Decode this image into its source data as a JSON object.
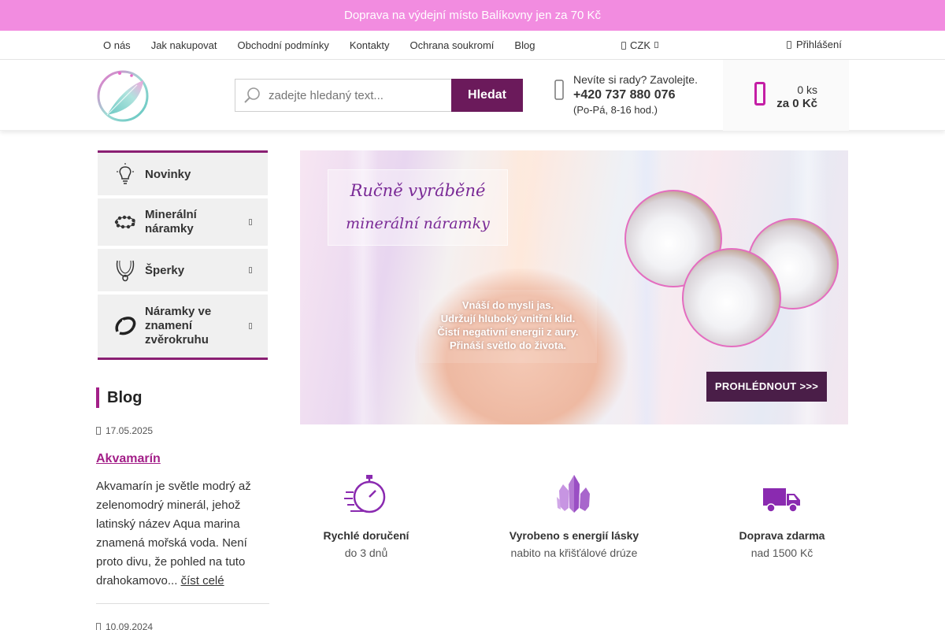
{
  "topbar": {
    "text": "Doprava na výdejní místo Balíkovny jen za 70 Kč"
  },
  "nav": {
    "links": [
      "O nás",
      "Jak nakupovat",
      "Obchodní podmínky",
      "Kontakty",
      "Ochrana soukromí",
      "Blog"
    ],
    "currency": "CZK",
    "login": "Přihlášení"
  },
  "header": {
    "search_placeholder": "zadejte hledaný text...",
    "search_button": "Hledat",
    "contact_question": "Nevíte si rady? Zavolejte.",
    "phone": "+420 737 880 076",
    "hours": "(Po-Pá, 8-16 hod.)",
    "cart_count": "0 ks",
    "cart_price": "za 0 Kč"
  },
  "menu": {
    "items": [
      {
        "label": "Novinky",
        "icon": "lightbulb-icon",
        "has_arrow": false
      },
      {
        "label": "Minerální náramky",
        "icon": "bead-bracelet-icon",
        "has_arrow": true
      },
      {
        "label": "Šperky",
        "icon": "necklace-icon",
        "has_arrow": true
      },
      {
        "label": "Náramky ve znamení zvěrokruhu",
        "icon": "zodiac-bracelet-icon",
        "has_arrow": true
      }
    ]
  },
  "blog": {
    "title": "Blog",
    "posts": [
      {
        "date": "17.05.2025",
        "title": "Akvamarín",
        "excerpt": "Akvamarín je světle modrý až zelenomodrý minerál, jehož latinský název Aqua marina znamená mořská voda. Není proto divu, že pohled na tuto drahokamovo...",
        "read_more": "číst celé"
      },
      {
        "date": "10.09.2024"
      }
    ]
  },
  "banner": {
    "title_line1": "Ručně vyráběné",
    "title_line2": "minerální náramky",
    "message_lines": [
      "Vnáší do mysli jas.",
      "Udržují hluboký vnitřní klid.",
      "Čistí negativní energii z aury.",
      "Přináší světlo do života."
    ],
    "cta": "PROHLÉDNOUT >>>"
  },
  "features": [
    {
      "title": "Rychlé doručení",
      "subtitle": "do 3 dnů",
      "icon": "stopwatch-icon"
    },
    {
      "title": "Vyrobeno s energií lásky",
      "subtitle": "nabito na křišťálové drúze",
      "icon": "crystal-icon"
    },
    {
      "title": "Doprava zdarma",
      "subtitle": "nad 1500 Kč",
      "icon": "truck-icon"
    }
  ],
  "colors": {
    "topbar": "#f28ce0",
    "primary": "#6b1a5b",
    "accent": "#a31f88",
    "feature_icon": "#8a2ab0"
  }
}
